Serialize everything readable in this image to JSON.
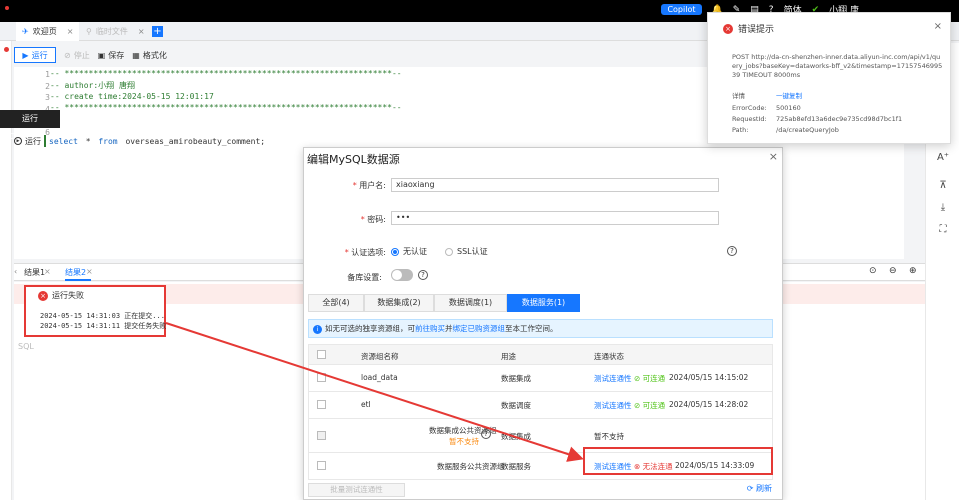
{
  "topbar": {
    "copilot": "Copilot",
    "lang": "简体",
    "user": "小翔 唐"
  },
  "tabs": [
    {
      "label": "欢迎页"
    },
    {
      "label": "临时文件"
    }
  ],
  "toolbar": {
    "run": "运行",
    "stop": "停止",
    "save": "保存",
    "format": "格式化"
  },
  "editor": {
    "line_numbers": [
      "1",
      "2",
      "3",
      "4",
      "5",
      "6"
    ],
    "line1": "-- ********************************************************************--",
    "line2": "-- author:小翔 唐翔",
    "line3": "-- create time:2024-05-15 12:01:17",
    "line4": "-- ********************************************************************--",
    "tooltip": "运行 Ctrl+Enter",
    "run_label": "运行",
    "sql_kw1": "select",
    "sql_mid": " * ",
    "sql_kw2": "from",
    "sql_rest": " overseas_amirobeauty_comment;"
  },
  "results": {
    "tab1": "结果1",
    "tab2": "结果2",
    "error_title": "运行失败",
    "log1": "2024-05-15 14:31:03 正在提交...",
    "log2": "2024-05-15 14:31:11 提交任务失败",
    "sql_hint": "SQL"
  },
  "dialog": {
    "title": "编辑MySQL数据源",
    "username_label": "用户名:",
    "username_value": "xiaoxiang",
    "password_label": "密码:",
    "password_value": "•••",
    "auth_label": "认证选项:",
    "auth_none": "无认证",
    "auth_ssl": "SSL认证",
    "backup_label": "备库设置:",
    "tabs": [
      "全部(4)",
      "数据集成(2)",
      "数据调度(1)",
      "数据服务(1)"
    ],
    "info_prefix": "如无可选的独享资源组，可",
    "info_link1": "前往购买",
    "info_mid": "并",
    "info_link2": "绑定已购资源组",
    "info_suffix": "至本工作空间。",
    "columns": [
      "资源组名称",
      "用途",
      "连通状态"
    ],
    "rows": [
      {
        "name": "load_data",
        "usage": "数据集成",
        "test": "测试连通性",
        "status": "可连通",
        "time": "2024/05/15 14:15:02"
      },
      {
        "name": "etl",
        "usage": "数据调度",
        "test": "测试连通性",
        "status": "可连通",
        "time": "2024/05/15 14:28:02"
      },
      {
        "name": "数据集成公共资源组",
        "sub": "暂不支持",
        "usage": "数据集成",
        "status": "暂不支持"
      },
      {
        "name": "数据服务公共资源组",
        "usage": "数据服务",
        "test": "测试连通性",
        "status": "无法连通",
        "time": "2024/05/15 14:33:09"
      }
    ],
    "batch_test": "批量测试连通性",
    "refresh": "刷新"
  },
  "error_panel": {
    "title": "错误提示",
    "message": "POST http://da-cn-shenzhen-inner.data.aliyun-inc.com/api/v1/query_jobs?baseKey=dataworks-bff_v2&timestamp=1715754699539 TIMEOUT 8000ms",
    "detail_label": "详情",
    "copy": "一键复制",
    "error_code_label": "ErrorCode:",
    "error_code": "500160",
    "request_id_label": "RequestId:",
    "request_id": "725ab8efd13a6dec9e735cd98d7bc1f1",
    "path_label": "Path:",
    "path": "/da/createQueryJob"
  },
  "colors": {
    "accent": "#1677ff",
    "error": "#e53935",
    "success": "#52c41a",
    "comment": "#2e7d32"
  }
}
